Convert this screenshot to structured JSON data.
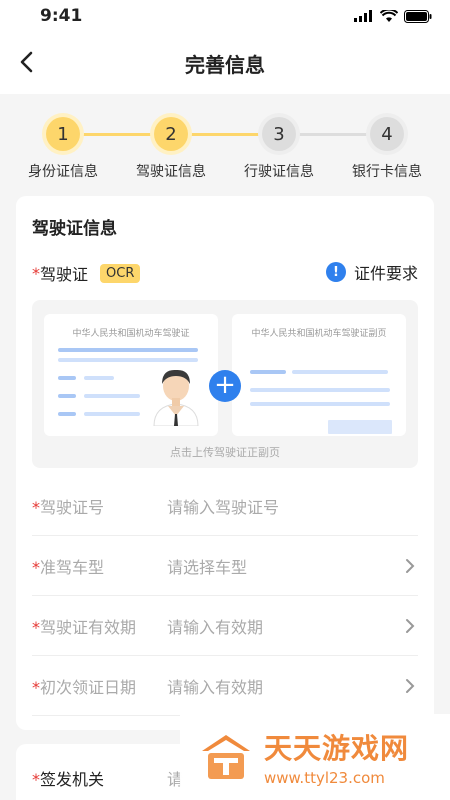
{
  "status_bar": {
    "time": "9:41"
  },
  "nav": {
    "title": "完善信息"
  },
  "steps": [
    {
      "number": "1",
      "label": "身份证信息",
      "state": "done"
    },
    {
      "number": "2",
      "label": "驾驶证信息",
      "state": "active"
    },
    {
      "number": "3",
      "label": "行驶证信息",
      "state": "todo"
    },
    {
      "number": "4",
      "label": "银行卡信息",
      "state": "todo"
    }
  ],
  "card": {
    "title": "驾驶证信息",
    "license_label": "驾驶证",
    "required_mark": "*",
    "ocr_badge": "OCR",
    "requirements_link": "证件要求",
    "upload": {
      "front_title": "中华人民共和国机动车驾驶证",
      "back_title": "中华人民共和国机动车驾驶证副页",
      "hint": "点击上传驾驶证正副页"
    },
    "fields": [
      {
        "label": "*驾驶证号",
        "placeholder": "请输入驾驶证号",
        "has_chevron": false
      },
      {
        "label": "*准驾车型",
        "placeholder": "请选择车型",
        "has_chevron": true
      },
      {
        "label": "*驾驶证有效期",
        "placeholder": "请输入有效期",
        "has_chevron": true
      },
      {
        "label": "*初次领证日期",
        "placeholder": "请输入有效期",
        "has_chevron": true
      }
    ]
  },
  "card2": {
    "required_mark": "*",
    "field_label": "签发机关",
    "placeholder_partial": "请"
  },
  "watermark": {
    "name": "天天游戏网",
    "url": "www.ttyl23.com"
  },
  "colors": {
    "accent_yellow": "#fdd66b",
    "primary_blue": "#2f80ed",
    "inactive_gray": "#dddddd",
    "required_red": "#e53935"
  },
  "icons": [
    "signal-icon",
    "wifi-icon",
    "battery-icon",
    "back-chevron-icon",
    "info-icon",
    "plus-icon",
    "chevron-right-icon",
    "avatar-icon",
    "logo-icon"
  ]
}
